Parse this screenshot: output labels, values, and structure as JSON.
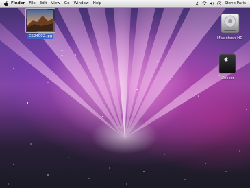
{
  "menubar": {
    "apple_icon": "apple-logo-icon",
    "app_name": "Finder",
    "items": [
      "File",
      "Edit",
      "View",
      "Go",
      "Window",
      "Help"
    ],
    "status_icons": [
      "bluetooth-icon",
      "wifi-icon",
      "volume-icon",
      "clock-icon"
    ],
    "user_name": "Steve Paris"
  },
  "desktop": {
    "file_icon": {
      "name": "CS24092.jpg",
      "selected": true,
      "icon": "photo-thumbnail-icon"
    },
    "drives": [
      {
        "label": "Macintosh HD",
        "icon": "hard-drive-icon"
      },
      {
        "label": "Sleeker",
        "icon": "external-drive-icon"
      }
    ]
  },
  "colors": {
    "selection": "#3b63c8",
    "menubar": "#e6e6e6",
    "wallpaper_magenta": "#c448bc",
    "wallpaper_purple": "#6a3f95"
  }
}
